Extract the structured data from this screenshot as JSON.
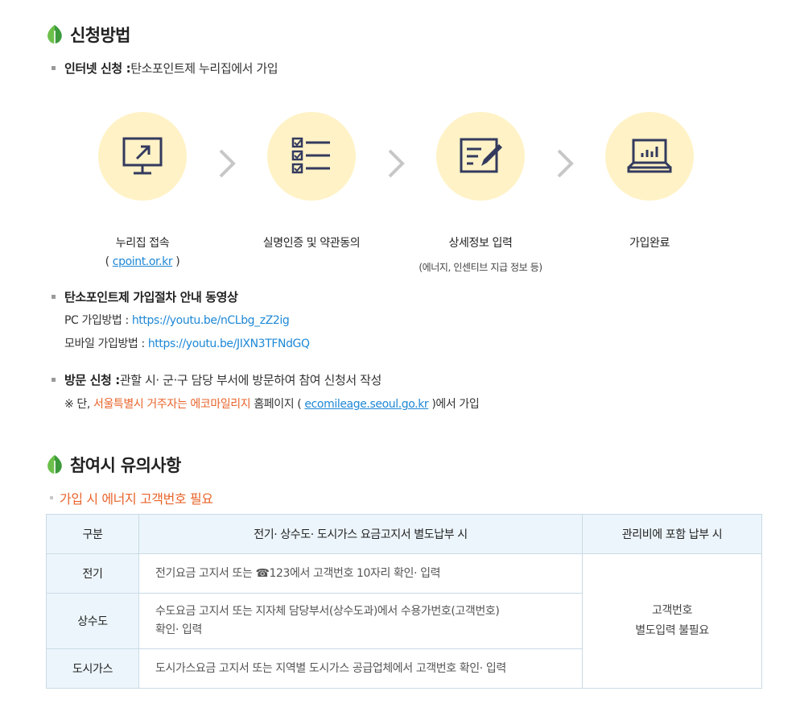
{
  "section1": {
    "title": "신청방법",
    "internet": {
      "label": "인터넷 신청 :",
      "text": " 탄소포인트제 누리집에서 가입"
    },
    "steps": [
      {
        "label": "누리집 접속",
        "sub_open": "( ",
        "sub_link": "cpoint.or.kr",
        "sub_close": " )"
      },
      {
        "label": "실명인증 및 약관동의"
      },
      {
        "label": "상세정보 입력",
        "small": "(에너지, 인센티브 지급 정보 등)"
      },
      {
        "label": "가입완료"
      }
    ],
    "video": {
      "title": "탄소포인트제 가입절차 안내 동영상",
      "pc_label": "PC 가입방법 : ",
      "pc_url": "https://youtu.be/nCLbg_zZ2ig",
      "mobile_label": "모바일 가입방법 : ",
      "mobile_url": "https://youtu.be/JIXN3TFNdGQ"
    },
    "visit": {
      "label": "방문 신청 :",
      "text": " 관할 시· 군·구 담당 부서에 방문하여 참여 신청서 작성",
      "note_prefix": "※ 단, ",
      "note_orange": "서울특별시 거주자는 에코마일리지",
      "note_mid": " 홈페이지 ( ",
      "note_link": "ecomileage.seoul.go.kr",
      "note_suffix": " )에서 가입"
    }
  },
  "section2": {
    "title": "참여시 유의사항",
    "notice": "가입 시 에너지 고객번호 필요",
    "table": {
      "headers": [
        "구분",
        "전기· 상수도· 도시가스 요금고지서 별도납부 시",
        "관리비에 포함 납부 시"
      ],
      "rows": [
        {
          "cat": "전기",
          "desc": "전기요금 고지서 또는 ☎123에서 고객번호 10자리 확인· 입력"
        },
        {
          "cat": "상수도",
          "desc1": "수도요금 고지서 또는 지자체 담당부서(상수도과)에서 수용가번호(고객번호)",
          "desc2": "확인· 입력"
        },
        {
          "cat": "도시가스",
          "desc": "도시가스요금 고지서 또는 지역별 도시가스 공급업체에서 고객번호 확인· 입력"
        }
      ],
      "mgmt1": "고객번호",
      "mgmt2": "별도입력 불필요"
    }
  },
  "colors": {
    "accent_green": "#3c9a3c",
    "circle_bg": "#fff2c6",
    "link_blue": "#1e88d6",
    "orange": "#e9642b",
    "icon_navy": "#333a5e"
  }
}
